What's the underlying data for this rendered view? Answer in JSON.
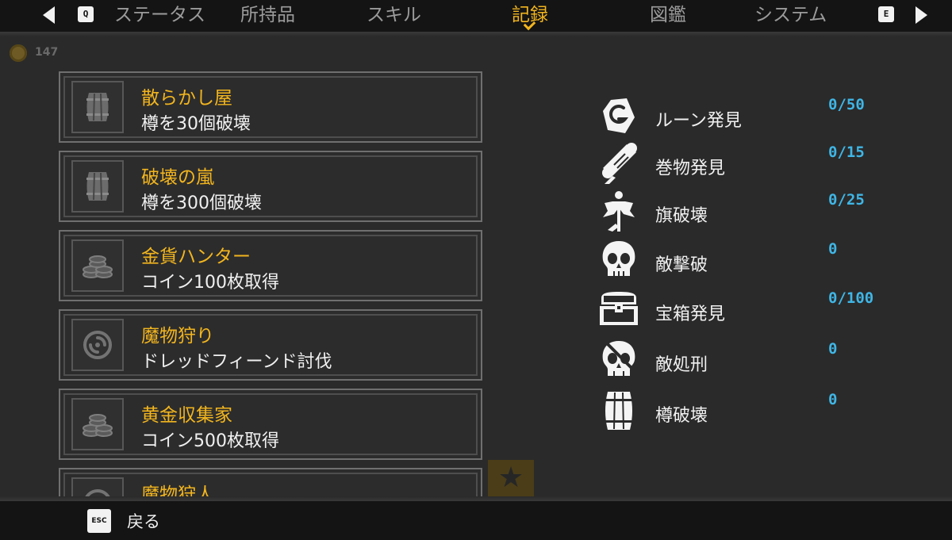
{
  "nav": {
    "prev_key": "Q",
    "next_key": "E",
    "tabs": [
      {
        "label": "ステータス",
        "active": false
      },
      {
        "label": "所持品",
        "active": false
      },
      {
        "label": "スキル",
        "active": false
      },
      {
        "label": "記録",
        "active": true
      },
      {
        "label": "図鑑",
        "active": false
      },
      {
        "label": "システム",
        "active": false
      }
    ]
  },
  "world": {
    "coin_count": "147"
  },
  "achievements": [
    {
      "title": "散らかし屋",
      "desc": "樽を30個破壊",
      "icon": "barrel-icon"
    },
    {
      "title": "破壊の嵐",
      "desc": "樽を300個破壊",
      "icon": "barrel-icon"
    },
    {
      "title": "金貨ハンター",
      "desc": "コイン100枚取得",
      "icon": "coin-stack-icon"
    },
    {
      "title": "魔物狩り",
      "desc": "ドレッドフィーンド討伐",
      "icon": "vortex-icon"
    },
    {
      "title": "黄金収集家",
      "desc": "コイン500枚取得",
      "icon": "coin-stack-icon"
    },
    {
      "title": "魔物狩人",
      "desc": "",
      "icon": "vortex-icon"
    }
  ],
  "stats": [
    {
      "label": "ルーン発見",
      "value": "0/50",
      "icon": "rune-icon"
    },
    {
      "label": "巻物発見",
      "value": "0/15",
      "icon": "scroll-icon"
    },
    {
      "label": "旗破壊",
      "value": "0/25",
      "icon": "flag-icon"
    },
    {
      "label": "敵撃破",
      "value": "0",
      "icon": "skull-icon"
    },
    {
      "label": "宝箱発見",
      "value": "0/100",
      "icon": "chest-icon"
    },
    {
      "label": "敵処刑",
      "value": "0",
      "icon": "crossed-skull-icon"
    },
    {
      "label": "樽破壊",
      "value": "0",
      "icon": "barrel-icon"
    }
  ],
  "footer": {
    "esc_key": "ESC",
    "back_label": "戻る"
  },
  "colors": {
    "accent": "#f2b51e",
    "value": "#3fb6e6",
    "bg": "#2a2a2a",
    "bar": "#141414"
  }
}
